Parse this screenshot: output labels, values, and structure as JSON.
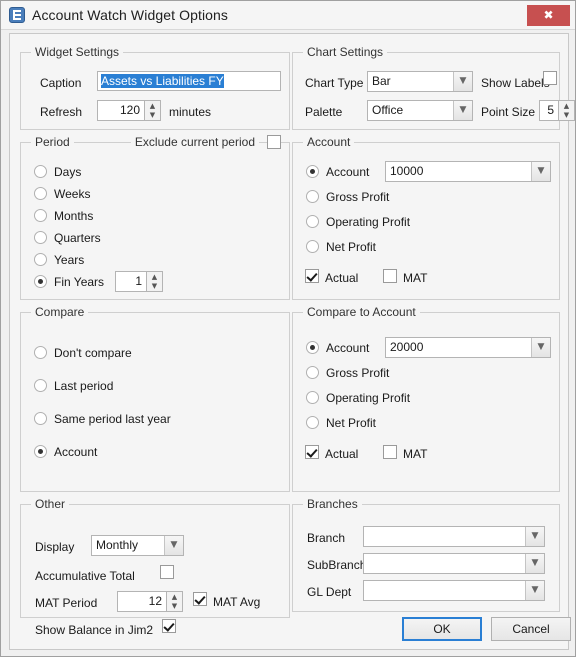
{
  "window": {
    "title": "Account Watch Widget Options",
    "icon": "app-icon",
    "close_label": "✖"
  },
  "widget_settings": {
    "legend": "Widget Settings",
    "caption_label": "Caption",
    "caption_value": "Assets vs Liabilities FY",
    "refresh_label": "Refresh",
    "refresh_value": "120",
    "refresh_units": "minutes"
  },
  "chart_settings": {
    "legend": "Chart Settings",
    "chart_type_label": "Chart Type",
    "chart_type_value": "Bar",
    "palette_label": "Palette",
    "palette_value": "Office",
    "show_labels_label": "Show Labels",
    "show_labels_checked": false,
    "point_size_label": "Point Size",
    "point_size_value": "5"
  },
  "period": {
    "legend": "Period",
    "exclude_label": "Exclude current period",
    "exclude_checked": false,
    "options": [
      {
        "label": "Days",
        "selected": false
      },
      {
        "label": "Weeks",
        "selected": false
      },
      {
        "label": "Months",
        "selected": false
      },
      {
        "label": "Quarters",
        "selected": false
      },
      {
        "label": "Years",
        "selected": false
      },
      {
        "label": "Fin Years",
        "selected": true
      }
    ],
    "fin_years_value": "1"
  },
  "account": {
    "legend": "Account",
    "options": [
      {
        "label": "Account",
        "selected": true
      },
      {
        "label": "Gross Profit",
        "selected": false
      },
      {
        "label": "Operating Profit",
        "selected": false
      },
      {
        "label": "Net Profit",
        "selected": false
      }
    ],
    "account_value": "10000",
    "actual_label": "Actual",
    "actual_checked": true,
    "mat_label": "MAT",
    "mat_checked": false
  },
  "compare": {
    "legend": "Compare",
    "options": [
      {
        "label": "Don't compare",
        "selected": false
      },
      {
        "label": "Last period",
        "selected": false
      },
      {
        "label": "Same period last year",
        "selected": false
      },
      {
        "label": "Account",
        "selected": true
      }
    ]
  },
  "compare_to_account": {
    "legend": "Compare to Account",
    "options": [
      {
        "label": "Account",
        "selected": true
      },
      {
        "label": "Gross Profit",
        "selected": false
      },
      {
        "label": "Operating Profit",
        "selected": false
      },
      {
        "label": "Net Profit",
        "selected": false
      }
    ],
    "account_value": "20000",
    "actual_label": "Actual",
    "actual_checked": true,
    "mat_label": "MAT",
    "mat_checked": false
  },
  "other": {
    "legend": "Other",
    "display_label": "Display",
    "display_value": "Monthly",
    "accumulative_label": "Accumulative Total",
    "accumulative_checked": false,
    "mat_period_label": "MAT Period",
    "mat_period_value": "12",
    "mat_avg_label": "MAT Avg",
    "mat_avg_checked": true,
    "show_balance_label": "Show Balance in Jim2",
    "show_balance_checked": true
  },
  "branches": {
    "legend": "Branches",
    "branch_label": "Branch",
    "branch_value": "",
    "subbranch_label": "SubBranch",
    "subbranch_value": "",
    "gldept_label": "GL Dept",
    "gldept_value": ""
  },
  "buttons": {
    "ok": "OK",
    "cancel": "Cancel"
  },
  "glyphs": {
    "chevron_down": "▼",
    "spin_up": "▲",
    "spin_down": "▼"
  }
}
